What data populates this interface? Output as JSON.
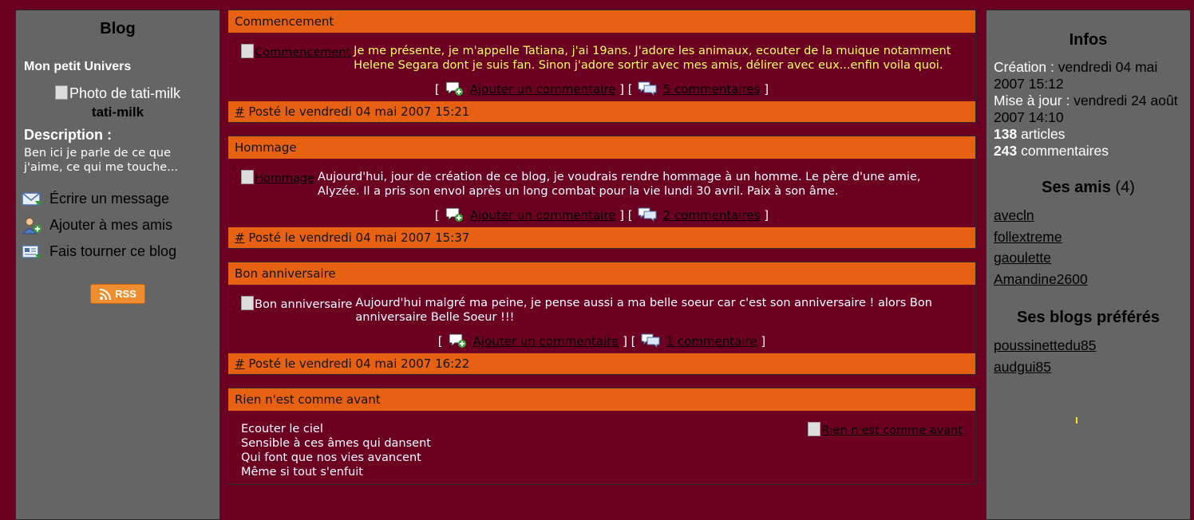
{
  "left": {
    "title": "Blog",
    "subtitle": "Mon petit Univers",
    "photo_alt": "Photo de tati-milk",
    "username": "tati-milk",
    "description_label": "Description :",
    "description_text": "Ben ici je parle de ce que j'aime, ce qui me touche...",
    "actions": [
      {
        "label": "Écrire un message",
        "icon": "envelope-icon"
      },
      {
        "label": "Ajouter à mes amis",
        "icon": "add-friend-icon"
      },
      {
        "label": "Fais tourner ce blog",
        "icon": "share-blog-icon"
      }
    ],
    "rss_label": "RSS"
  },
  "posts": [
    {
      "title": "Commencement",
      "image_alt": "Commencement",
      "text": "Je me présente, je m'appelle Tatiana, j'ai 19ans. J'adore les animaux, ecouter de la muique notamment Helene Segara dont je suis fan. Sinon j'adore sortir avec mes amis, délirer avec eux...enfin voila quoi.",
      "text_color": "#ffff66",
      "add_comment": "Ajouter un commentaire",
      "comments": "5 commentaires",
      "permalink": "#",
      "posted": "Posté le vendredi 04 mai 2007 15:21"
    },
    {
      "title": "Hommage",
      "image_alt": "Hommage",
      "text": "Aujourd'hui, jour de création de ce blog, je voudrais rendre hommage à un homme. Le père d'une amie, Alyzée. Il a pris son envol après un long combat pour la vie lundi 30 avril. Paix à son âme.",
      "text_color": "#ffffff",
      "add_comment": "Ajouter un commentaire",
      "comments": "2 commentaires",
      "permalink": "#",
      "posted": "Posté le vendredi 04 mai 2007 15:37"
    },
    {
      "title": "Bon anniversaire",
      "image_alt": "Bon anniversaire",
      "text": "Aujourd'hui malgré ma peine, je pense aussi a ma belle soeur car c'est son anniversaire ! alors Bon anniversaire Belle Soeur !!!",
      "text_color": "#ffffff",
      "add_comment": "Ajouter un commentaire",
      "comments": "1 commentaire",
      "permalink": "#",
      "posted": "Posté le vendredi 04 mai 2007 16:22"
    },
    {
      "title": "Rien n'est comme avant",
      "image_alt": "Rien n'est comme avant",
      "lines": [
        "Ecouter le ciel",
        "Sensible à ces âmes qui dansent",
        "Qui font que nos vies avancent",
        "Même si tout s'enfuit"
      ]
    }
  ],
  "right": {
    "infos_title": "Infos",
    "creation_label": "Création :",
    "creation_value": "vendredi 04 mai 2007 15:12",
    "update_label": "Mise à jour :",
    "update_value": "vendredi 24 août 2007 14:10",
    "articles_count": "138",
    "articles_label": "articles",
    "comments_count": "243",
    "comments_label": "commentaires",
    "friends_title": "Ses amis",
    "friends_count": "(4)",
    "friends": [
      "avecln",
      "follextreme",
      "gaoulette",
      "Amandine2600"
    ],
    "fav_title": "Ses blogs préférés",
    "favorites": [
      "poussinettedu85",
      "audgui85"
    ]
  },
  "colors": {
    "background": "#6b0022",
    "sidebar": "#656565",
    "header_bar": "#e66212",
    "accent_text": "#ffff66"
  }
}
